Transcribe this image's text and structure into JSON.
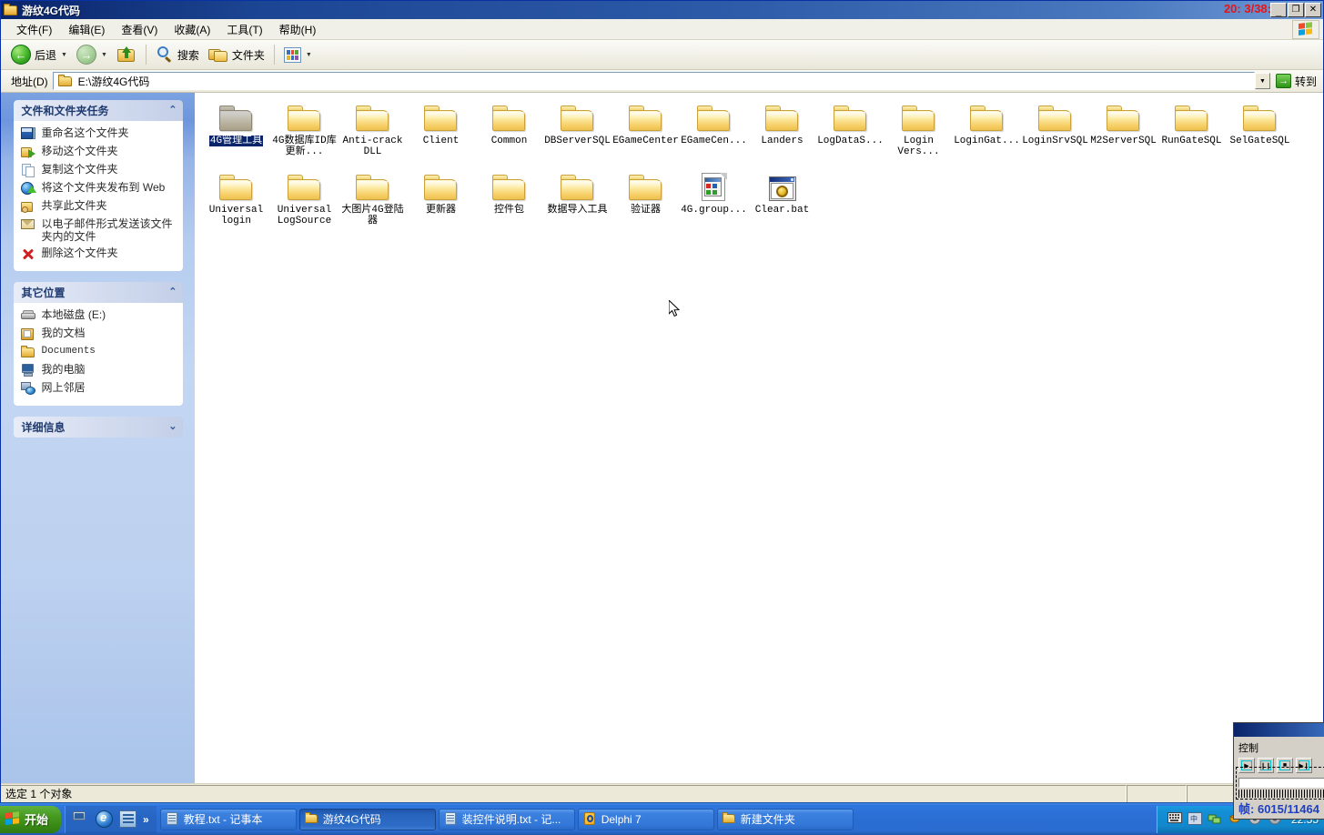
{
  "window": {
    "title": "游纹4G代码",
    "title_icon": "folder-icon",
    "overlay_clock": "20: 3/38:",
    "buttons": {
      "minimize": "_",
      "maximize": "❐",
      "close": "✕"
    }
  },
  "menubar": {
    "items": [
      {
        "label": "文件(F)",
        "name": "menu-file"
      },
      {
        "label": "编辑(E)",
        "name": "menu-edit"
      },
      {
        "label": "查看(V)",
        "name": "menu-view"
      },
      {
        "label": "收藏(A)",
        "name": "menu-favorites"
      },
      {
        "label": "工具(T)",
        "name": "menu-tools"
      },
      {
        "label": "帮助(H)",
        "name": "menu-help"
      }
    ],
    "logo": "windows-flag-icon"
  },
  "toolbar": {
    "back_label": "后退",
    "forward_label": "",
    "up_label": "",
    "search_label": "搜索",
    "folders_label": "文件夹",
    "views_label": ""
  },
  "address": {
    "label": "地址(D)",
    "value": "E:\\游纹4G代码",
    "go_label": "转到",
    "dropdown_glyph": "▼"
  },
  "sidebar": {
    "panels": [
      {
        "title": "文件和文件夹任务",
        "collapse_glyph": "⌃",
        "items": [
          {
            "label": "重命名这个文件夹",
            "icon": "rename-icon"
          },
          {
            "label": "移动这个文件夹",
            "icon": "move-icon"
          },
          {
            "label": "复制这个文件夹",
            "icon": "copy-icon"
          },
          {
            "label": "将这个文件夹发布到 Web",
            "icon": "publish-web-icon"
          },
          {
            "label": "共享此文件夹",
            "icon": "share-folder-icon"
          },
          {
            "label": "以电子邮件形式发送该文件夹内的文件",
            "icon": "email-icon"
          },
          {
            "label": "删除这个文件夹",
            "icon": "delete-icon"
          }
        ]
      },
      {
        "title": "其它位置",
        "collapse_glyph": "⌃",
        "items": [
          {
            "label": "本地磁盘 (E:)",
            "icon": "hard-drive-icon"
          },
          {
            "label": "我的文档",
            "icon": "my-documents-icon"
          },
          {
            "label": "Documents",
            "icon": "folder-icon"
          },
          {
            "label": "我的电脑",
            "icon": "my-computer-icon"
          },
          {
            "label": "网上邻居",
            "icon": "network-neighborhood-icon"
          }
        ]
      },
      {
        "title": "详细信息",
        "collapse_glyph": "⌄",
        "items": []
      }
    ]
  },
  "files": [
    {
      "name": "4G管理工具",
      "type": "folder",
      "selected": true
    },
    {
      "name": "4G数据库ID库更新...",
      "type": "folder",
      "selected": false
    },
    {
      "name": "Anti-crack DLL",
      "type": "folder",
      "selected": false
    },
    {
      "name": "Client",
      "type": "folder",
      "selected": false
    },
    {
      "name": "Common",
      "type": "folder",
      "selected": false
    },
    {
      "name": "DBServerSQL",
      "type": "folder",
      "selected": false
    },
    {
      "name": "EGameCenter",
      "type": "folder",
      "selected": false
    },
    {
      "name": "EGameCen...",
      "type": "folder",
      "selected": false
    },
    {
      "name": "Landers",
      "type": "folder",
      "selected": false
    },
    {
      "name": "LogDataS...",
      "type": "folder",
      "selected": false
    },
    {
      "name": "Login Vers...",
      "type": "folder",
      "selected": false
    },
    {
      "name": "LoginGat...",
      "type": "folder",
      "selected": false
    },
    {
      "name": "LoginSrvSQL",
      "type": "folder",
      "selected": false
    },
    {
      "name": "M2ServerSQL",
      "type": "folder",
      "selected": false
    },
    {
      "name": "RunGateSQL",
      "type": "folder",
      "selected": false
    },
    {
      "name": "SelGateSQL",
      "type": "folder",
      "selected": false
    },
    {
      "name": "Universal login",
      "type": "folder",
      "selected": false
    },
    {
      "name": "Universal LogSource",
      "type": "folder",
      "selected": false
    },
    {
      "name": "大图片4G登陆器",
      "type": "folder",
      "selected": false
    },
    {
      "name": "更新器",
      "type": "folder",
      "selected": false
    },
    {
      "name": "控件包",
      "type": "folder",
      "selected": false
    },
    {
      "name": "数据导入工具",
      "type": "folder",
      "selected": false
    },
    {
      "name": "验证器",
      "type": "folder",
      "selected": false
    },
    {
      "name": "4G.group...",
      "type": "document",
      "selected": false
    },
    {
      "name": "Clear.bat",
      "type": "batch",
      "selected": false
    }
  ],
  "statusbar": {
    "main": "选定 1 个对象",
    "pane2": "",
    "pane3": ""
  },
  "taskbar": {
    "start_label": "开始",
    "quicklaunch": [
      {
        "name": "my-computer-icon"
      },
      {
        "name": "internet-explorer-icon"
      },
      {
        "name": "show-desktop-icon"
      }
    ],
    "overflow_glyph": "»",
    "buttons": [
      {
        "label": "教程.txt - 记事本",
        "icon": "notepad-icon",
        "active": false
      },
      {
        "label": "游纹4G代码",
        "icon": "folder-icon",
        "active": true
      },
      {
        "label": "装控件说明.txt - 记...",
        "icon": "notepad-icon",
        "active": false
      },
      {
        "label": "Delphi 7",
        "icon": "delphi-icon",
        "active": false
      },
      {
        "label": "新建文件夹",
        "icon": "folder-icon",
        "active": false
      }
    ],
    "tray": {
      "icons": [
        "keyboard-icon",
        "ime-icon",
        "network-icon",
        "antivirus-icon",
        "volume-icon",
        "shield-icon"
      ],
      "clock": "22:55"
    }
  },
  "control_panel": {
    "title": "控制",
    "buttons": [
      {
        "glyph": "▶",
        "name": "play-button"
      },
      {
        "glyph": "❙❙",
        "name": "pause-button"
      },
      {
        "glyph": "■",
        "name": "stop-button"
      },
      {
        "glyph": "▶❙",
        "name": "next-frame-button"
      }
    ],
    "frame_label": "帧:",
    "frame_value": "6015/11464"
  }
}
